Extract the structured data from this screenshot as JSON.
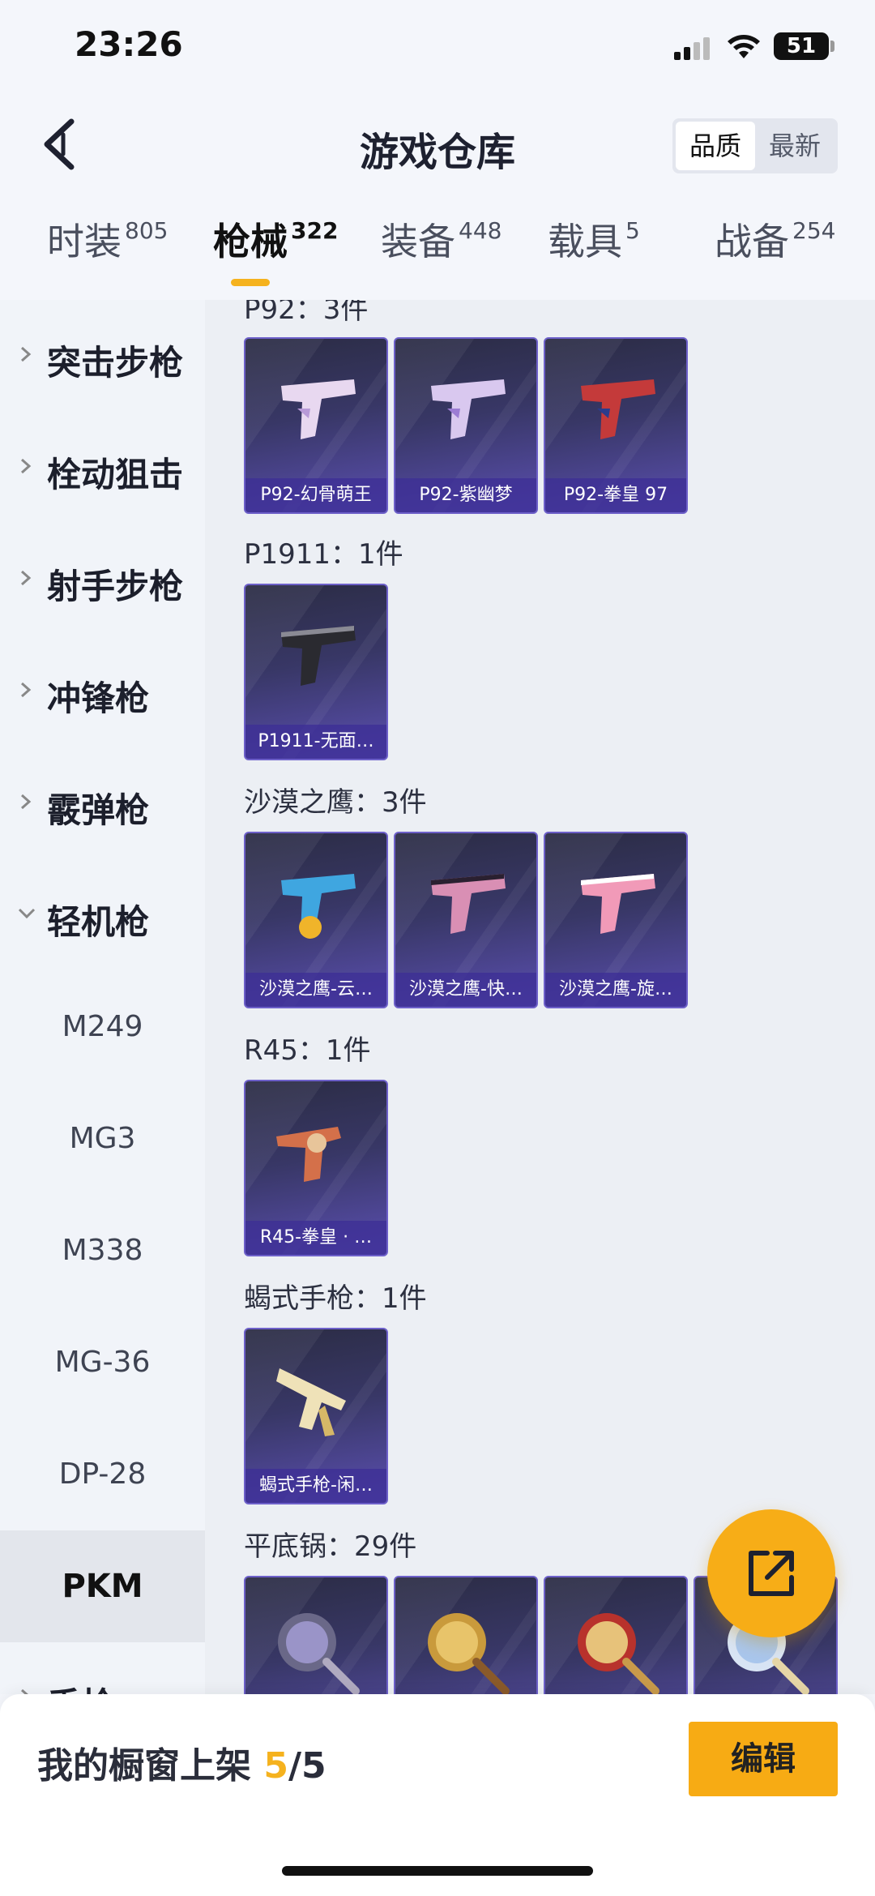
{
  "status_bar": {
    "time": "23:26",
    "battery": "51"
  },
  "header": {
    "title": "游戏仓库",
    "sort_options": [
      "品质",
      "最新"
    ],
    "sort_selected": "品质"
  },
  "tabs": [
    {
      "label": "时装",
      "count": "805"
    },
    {
      "label": "枪械",
      "count": "322"
    },
    {
      "label": "装备",
      "count": "448"
    },
    {
      "label": "载具",
      "count": "5"
    },
    {
      "label": "战备",
      "count": "254"
    }
  ],
  "sidebar": {
    "categories": [
      {
        "label": "突击步枪",
        "expanded": false
      },
      {
        "label": "栓动狙击",
        "expanded": false
      },
      {
        "label": "射手步枪",
        "expanded": false
      },
      {
        "label": "冲锋枪",
        "expanded": false
      },
      {
        "label": "霰弹枪",
        "expanded": false
      },
      {
        "label": "轻机枪",
        "expanded": true
      }
    ],
    "subitems": [
      "M249",
      "MG3",
      "M338",
      "MG-36",
      "DP-28",
      "PKM"
    ],
    "selected_subitem": "PKM",
    "partial_category": "手枪"
  },
  "groups": [
    {
      "title": "P92：3件",
      "items": [
        "P92-幻骨萌王",
        "P92-紫幽梦",
        "P92-拳皇 97"
      ]
    },
    {
      "title": "P1911：1件",
      "items": [
        "P1911-无面…"
      ]
    },
    {
      "title": "沙漠之鹰：3件",
      "items": [
        "沙漠之鹰-云…",
        "沙漠之鹰-快…",
        "沙漠之鹰-旋…"
      ]
    },
    {
      "title": "R45：1件",
      "items": [
        "R45-拳皇 · …"
      ]
    },
    {
      "title": "蝎式手枪：1件",
      "items": [
        "蝎式手枪-闲…"
      ]
    },
    {
      "title": "平底锅：29件",
      "items": [
        "",
        "",
        "",
        ""
      ]
    }
  ],
  "showcase": {
    "label": "我的橱窗上架 ",
    "current": "5",
    "total": "/5",
    "edit_label": "编辑"
  },
  "colors": {
    "accent": "#f7ab14",
    "card_purple": "#5b4fb1"
  }
}
